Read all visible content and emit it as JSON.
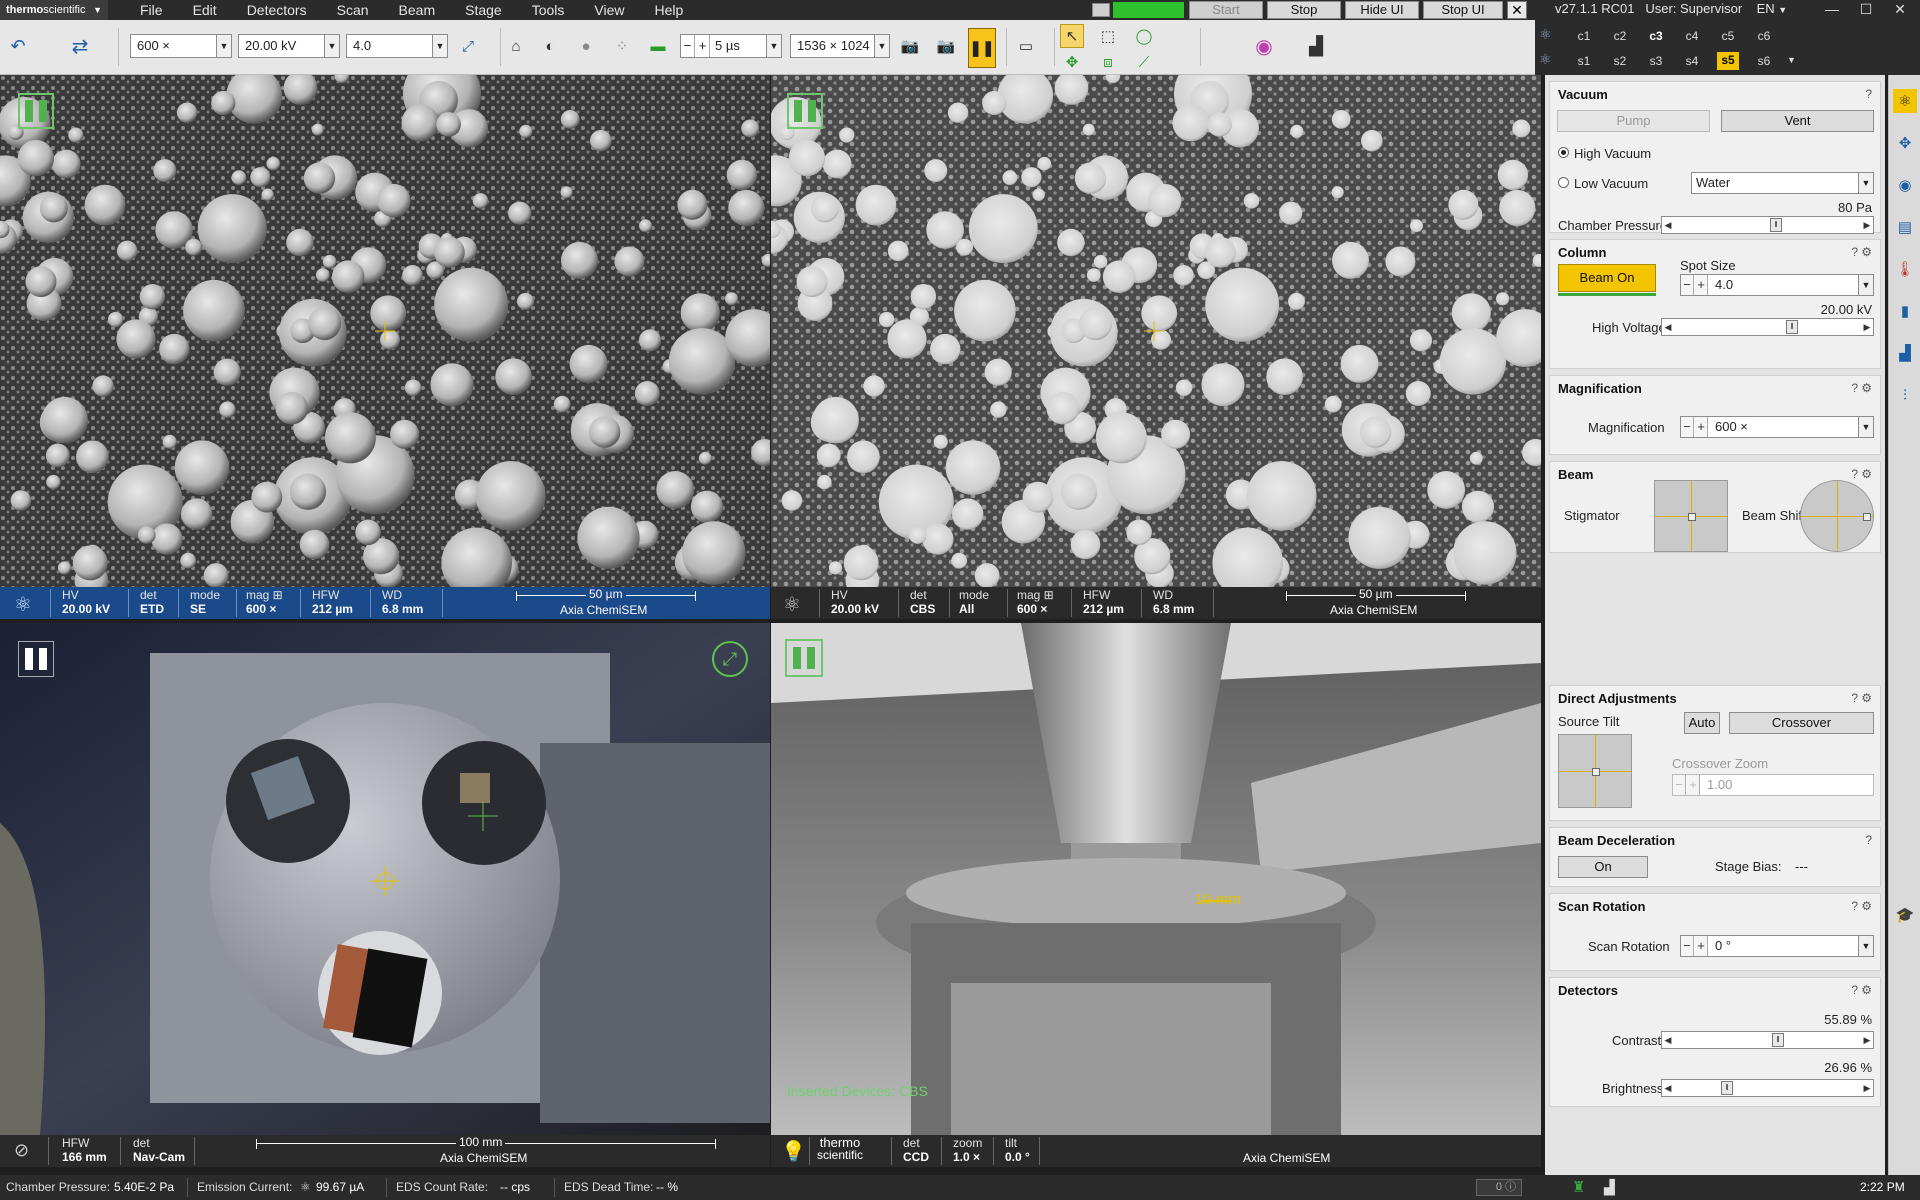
{
  "app": {
    "brand_bold": "thermo",
    "brand_rest": "scientific"
  },
  "menu": [
    "File",
    "Edit",
    "Detectors",
    "Scan",
    "Beam",
    "Stage",
    "Tools",
    "View",
    "Help"
  ],
  "top_buttons": {
    "start": "Start",
    "stop": "Stop",
    "hide_ui": "Hide UI",
    "stop_ui": "Stop UI",
    "close": "✕"
  },
  "version": "v27.1.1 RC01",
  "user": "User: Supervisor",
  "language": "EN",
  "toolbar": {
    "magnification": "600 ×",
    "voltage": "20.00 kV",
    "spot": "4.0",
    "dwell": "5 µs",
    "resolution": "1536 × 1024"
  },
  "presets": {
    "row1": [
      "c1",
      "c2",
      "c3",
      "c4",
      "c5",
      "c6"
    ],
    "row2": [
      "s1",
      "s2",
      "s3",
      "s4",
      "s5",
      "s6"
    ],
    "bold_row1": "c3",
    "selected_row2": "s5"
  },
  "quads": {
    "q1": {
      "hv_label": "HV",
      "hv": "20.00 kV",
      "det_label": "det",
      "det": "ETD",
      "mode_label": "mode",
      "mode": "SE",
      "mag_label": "mag ⊞",
      "mag": "600 ×",
      "hfw_label": "HFW",
      "hfw": "212 µm",
      "wd_label": "WD",
      "wd": "6.8 mm",
      "scale": "50 µm",
      "instrument": "Axia ChemiSEM"
    },
    "q2": {
      "hv_label": "HV",
      "hv": "20.00 kV",
      "det_label": "det",
      "det": "CBS",
      "mode_label": "mode",
      "mode": "All",
      "mag_label": "mag ⊞",
      "mag": "600 ×",
      "hfw_label": "HFW",
      "hfw": "212 µm",
      "wd_label": "WD",
      "wd": "6.8 mm",
      "scale": "50 µm",
      "instrument": "Axia ChemiSEM"
    },
    "q3": {
      "hfw_label": "HFW",
      "hfw": "166 mm",
      "det_label": "det",
      "det": "Nav-Cam",
      "scale": "100 mm",
      "instrument": "Axia ChemiSEM"
    },
    "q4": {
      "logo_top": "thermo",
      "logo_bottom": "scientific",
      "det_label": "det",
      "det": "CCD",
      "zoom_label": "zoom",
      "zoom": "1.0 ×",
      "tilt_label": "tilt",
      "tilt": "0.0 °",
      "instrument": "Axia ChemiSEM",
      "overlay_measure": "10 mm",
      "overlay_devices": "Inserted Devices: CBS"
    }
  },
  "panel": {
    "vacuum": {
      "title": "Vacuum",
      "help": "?",
      "pump": "Pump",
      "vent": "Vent",
      "high": "High Vacuum",
      "low": "Low Vacuum",
      "gas": "Water",
      "pressure_value": "80 Pa",
      "pressure_label": "Chamber Pressure",
      "pressure_level": 0.55
    },
    "column": {
      "title": "Column",
      "help": "?",
      "beam_on": "Beam On",
      "spot_label": "Spot Size",
      "spot": "4.0",
      "hv_value": "20.00 kV",
      "hv_label": "High Voltage",
      "hv_level": 0.64
    },
    "magnification": {
      "title": "Magnification",
      "help": "?",
      "label": "Magnification",
      "value": "600 ×"
    },
    "beam": {
      "title": "Beam",
      "help": "?",
      "stig": "Stigmator",
      "shift": "Beam Shift"
    },
    "direct": {
      "title": "Direct Adjustments",
      "help": "?",
      "source_tilt": "Source Tilt",
      "auto": "Auto",
      "crossover": "Crossover",
      "cz_label": "Crossover Zoom",
      "cz_value": "1.00"
    },
    "decel": {
      "title": "Beam Deceleration",
      "help": "?",
      "on": "On",
      "bias_label": "Stage Bias:",
      "bias_value": "---"
    },
    "rotation": {
      "title": "Scan Rotation",
      "help": "?",
      "label": "Scan Rotation",
      "value": "0 °"
    },
    "detectors": {
      "title": "Detectors",
      "help": "?",
      "contrast_value": "55.89 %",
      "contrast_label": "Contrast",
      "contrast_level": 0.5589,
      "brightness_value": "26.96 %",
      "brightness_label": "Brightness",
      "brightness_level": 0.2696
    }
  },
  "status": {
    "cp_label": "Chamber Pressure:",
    "cp_value": "5.40E-2 Pa",
    "ec_label": "Emission Current:",
    "ec_value": "99.67 µA",
    "eds_rate_label": "EDS Count Rate:",
    "eds_rate_value": "-- cps",
    "eds_dead_label": "EDS Dead Time:",
    "eds_dead_value": "-- %",
    "counter": "0",
    "time": "2:22 PM"
  }
}
